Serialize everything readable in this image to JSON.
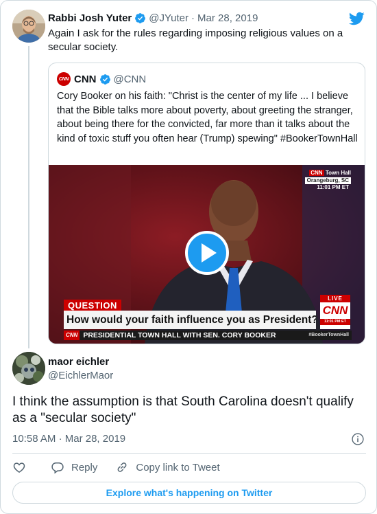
{
  "tweet": {
    "author_name": "Rabbi Josh Yuter",
    "author_handle": "@JYuter",
    "separator": "·",
    "date": "Mar 28, 2019",
    "text": "Again I ask for the rules regarding imposing religious values on a secular society.",
    "icons": [
      "verified-badge-icon",
      "twitter-bird-icon"
    ]
  },
  "quoted": {
    "avatar_text": "CNN",
    "author_name": "CNN",
    "author_handle": "@CNN",
    "text": "Cory Booker on his faith: \"Christ is the center of my life ... I believe that the Bible talks more about poverty, about greeting the stranger, about being there for the convicted, far more than it talks about the kind of toxic stuff you often hear (Trump) spewing\" #BookerTownHall",
    "video": {
      "brand_small": "CNN",
      "event": "Town Hall",
      "location": "Orangeburg, SC",
      "time": "11:01 PM ET",
      "question_label": "QUESTION",
      "question": "How would your faith influence you as President?",
      "live": "LIVE",
      "cnn_logo": "CNN",
      "live_time": "11:01 PM ET",
      "ticker_brand": "CNN",
      "ticker": "PRESIDENTIAL TOWN HALL WITH SEN. CORY BOOKER",
      "hashtag": "#BookerTownHall"
    }
  },
  "reply": {
    "author_name": "maor eichler",
    "author_handle": "@EichlerMaor",
    "text": "I think the assumption is that South Carolina doesn't qualify as a \"secular society\"",
    "time": "10:58 AM",
    "separator": "·",
    "date": "Mar 28, 2019"
  },
  "actions": {
    "like_icon": "heart-icon",
    "reply_label": "Reply",
    "copy_label": "Copy link to Tweet"
  },
  "explore_label": "Explore what's happening on Twitter",
  "colors": {
    "accent": "#1d9bf0",
    "text": "#0f1419",
    "muted": "#536471",
    "border": "#cfd9de",
    "cnn_red": "#cc0000"
  }
}
